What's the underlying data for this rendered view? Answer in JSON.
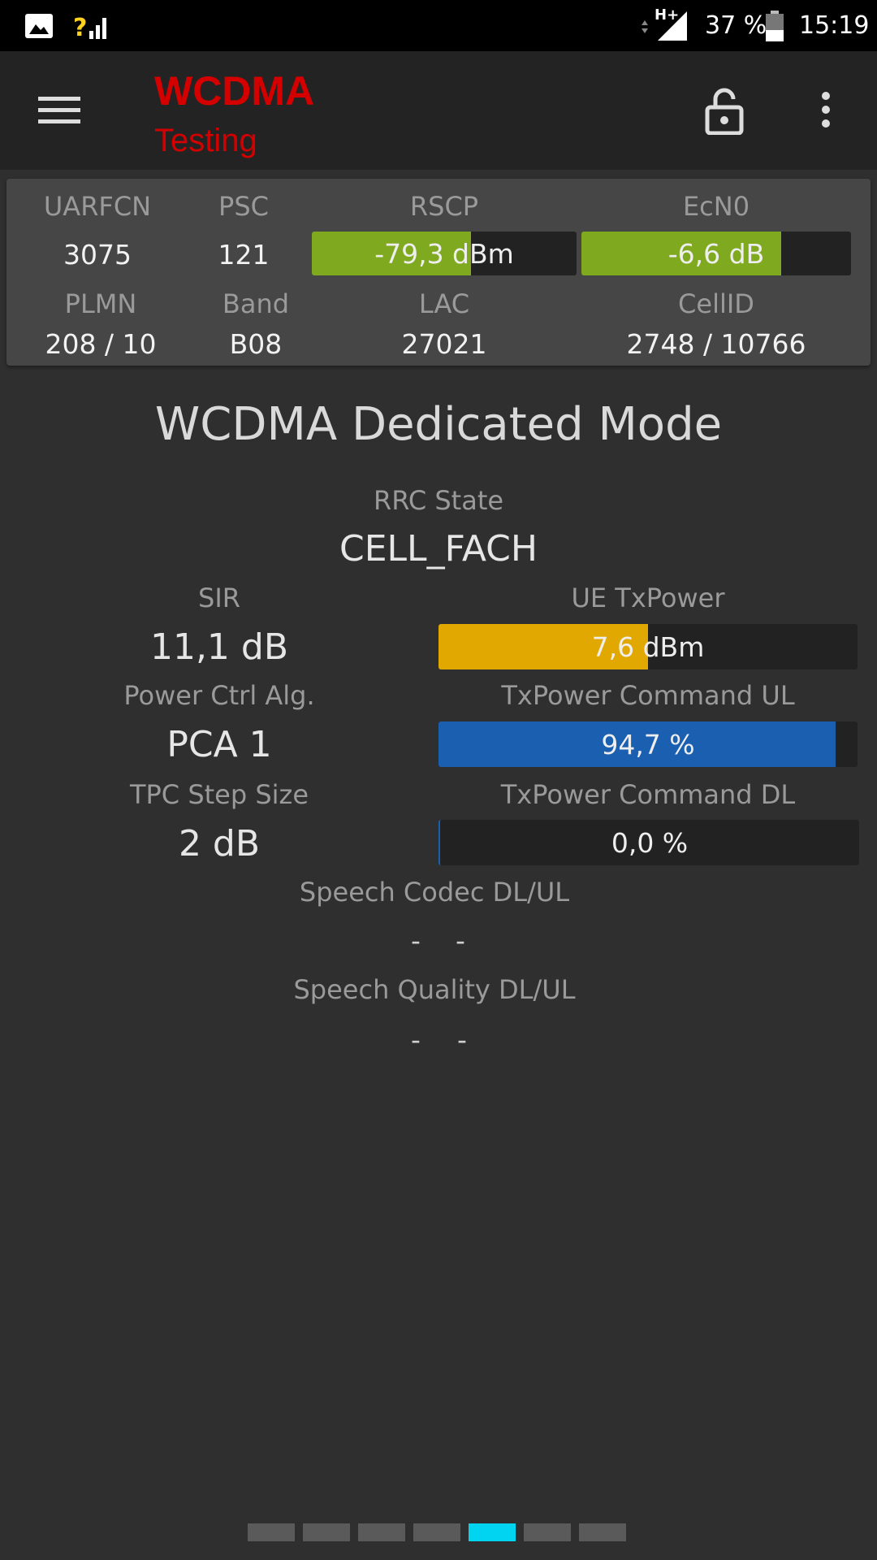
{
  "status_bar": {
    "network_type": "H+",
    "battery": "37 %",
    "time": "15:19",
    "icons": [
      "image-icon",
      "signal-unknown-icon",
      "data-arrows-icon",
      "cell-signal-icon",
      "battery-icon"
    ]
  },
  "app_bar": {
    "title": "WCDMA",
    "subtitle": "Testing",
    "title_color": "#d40000",
    "icons": [
      "menu-icon",
      "unlock-icon",
      "more-vert-icon"
    ]
  },
  "cell_panel": {
    "uarfcn": {
      "label": "UARFCN",
      "value": "3075"
    },
    "psc": {
      "label": "PSC",
      "value": "121"
    },
    "rscp": {
      "label": "RSCP",
      "value": "-79,3 dBm",
      "fill_fraction": 0.6,
      "color": "#7faa1f"
    },
    "ecn0": {
      "label": "EcN0",
      "value": "-6,6 dB",
      "fill_fraction": 0.74,
      "color": "#7faa1f"
    },
    "plmn": {
      "label": "PLMN",
      "value": "208 / 10"
    },
    "band": {
      "label": "Band",
      "value": "B08"
    },
    "lac": {
      "label": "LAC",
      "value": "27021"
    },
    "cellid": {
      "label": "CellID",
      "value": "2748 / 10766"
    }
  },
  "main": {
    "heading": "WCDMA Dedicated Mode",
    "rrc_state": {
      "label": "RRC State",
      "value": "CELL_FACH"
    },
    "sir": {
      "label": "SIR",
      "value": "11,1 dB"
    },
    "ue_txpower": {
      "label": "UE TxPower",
      "value": "7,6 dBm",
      "fill_fraction": 0.5,
      "color": "#e0a800"
    },
    "power_ctrl": {
      "label": "Power Ctrl Alg.",
      "value": "PCA 1"
    },
    "tx_cmd_ul": {
      "label": "TxPower Command UL",
      "value": "94,7 %",
      "fill_fraction": 0.947,
      "color": "#1a5fb0"
    },
    "tpc_step": {
      "label": "TPC Step Size",
      "value": "2 dB"
    },
    "tx_cmd_dl": {
      "label": "TxPower Command DL",
      "value": "0,0 %",
      "fill_fraction": 0.0,
      "color": "#1a5fb0"
    },
    "speech_codec": {
      "label": "Speech Codec DL/UL",
      "dl": "-",
      "ul": "-"
    },
    "speech_quality": {
      "label": "Speech Quality DL/UL",
      "dl": "-",
      "ul": "-"
    }
  },
  "page_indicator": {
    "count": 7,
    "active_index": 4,
    "active_color": "#00d4f0"
  }
}
